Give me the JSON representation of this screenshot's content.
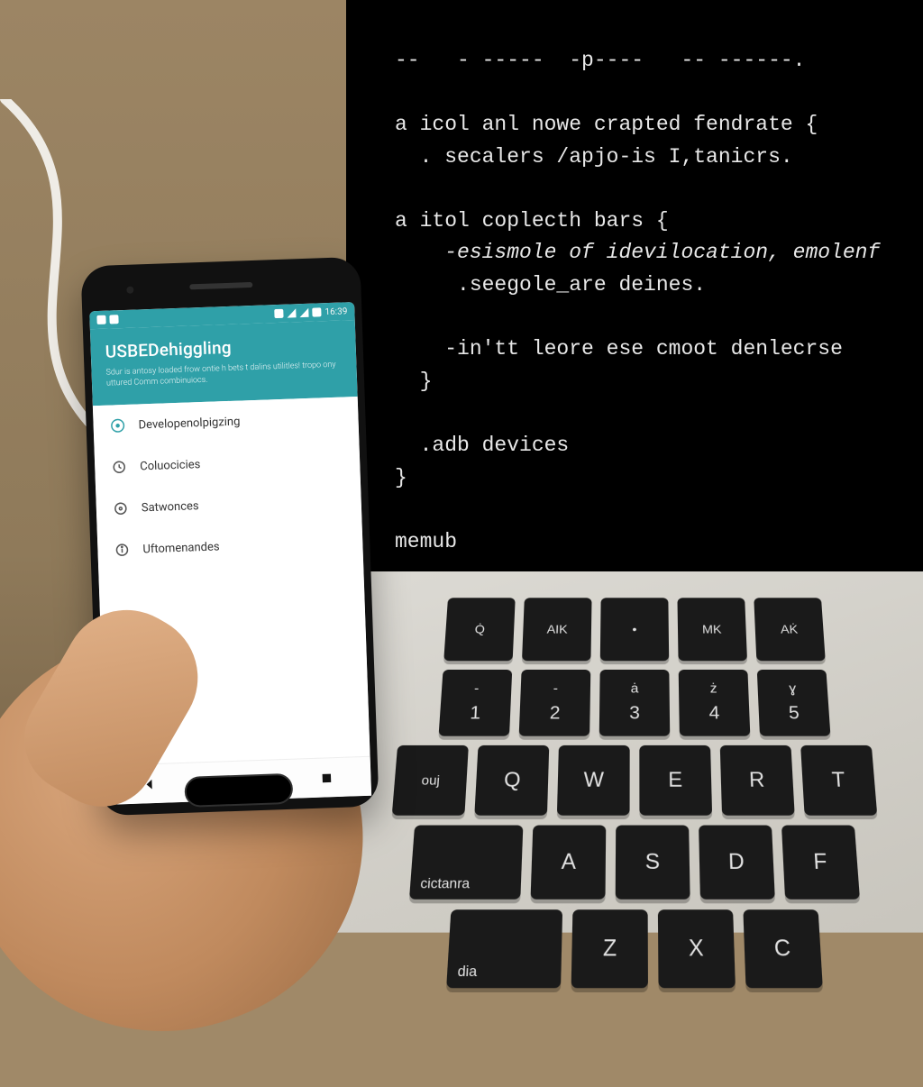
{
  "phone": {
    "status": {
      "time": "16:39"
    },
    "header": {
      "title": "USBEDehiggling",
      "subtitle": "Sdur is antosy loaded frow ontie h bets t dalins utilitles! tropo ony uttured Comm combinuiocs."
    },
    "items": [
      {
        "icon": "developer",
        "label": "Developenolpigzing"
      },
      {
        "icon": "cloud",
        "label": "Coluocicies"
      },
      {
        "icon": "settings",
        "label": "Satwonces"
      },
      {
        "icon": "info",
        "label": "Uftomenandes"
      }
    ]
  },
  "terminal": {
    "lines": [
      "--   - -----  -p----   -- ------.",
      "",
      "a icol anl nowe crapted fendrate {",
      "  . secalers /apjo-is I,tanicrs.",
      "",
      "a itol coplecth bars {",
      "    -esismole of idevilocation, emolenf",
      "     .seegole_are deines.",
      "",
      "    -in'tt leore ese cmoot denlecrse",
      "  }",
      "",
      "  .adb devices",
      "}",
      "",
      "memub"
    ]
  },
  "keys": {
    "row0": [
      "Q̇",
      "AIK",
      "•",
      "MK",
      "AK̇"
    ],
    "row1": [
      [
        "-",
        "1"
      ],
      [
        "-",
        "2"
      ],
      [
        "ȧ",
        "3"
      ],
      [
        "ż",
        "4"
      ],
      [
        "ɣ",
        "5"
      ]
    ],
    "row2": [
      "ouj",
      "Q",
      "W",
      "E",
      "R",
      "T"
    ],
    "row3": [
      "cictanra",
      "A",
      "S",
      "D",
      "F"
    ],
    "row4": [
      "dia",
      "Z",
      "X",
      "C"
    ]
  }
}
